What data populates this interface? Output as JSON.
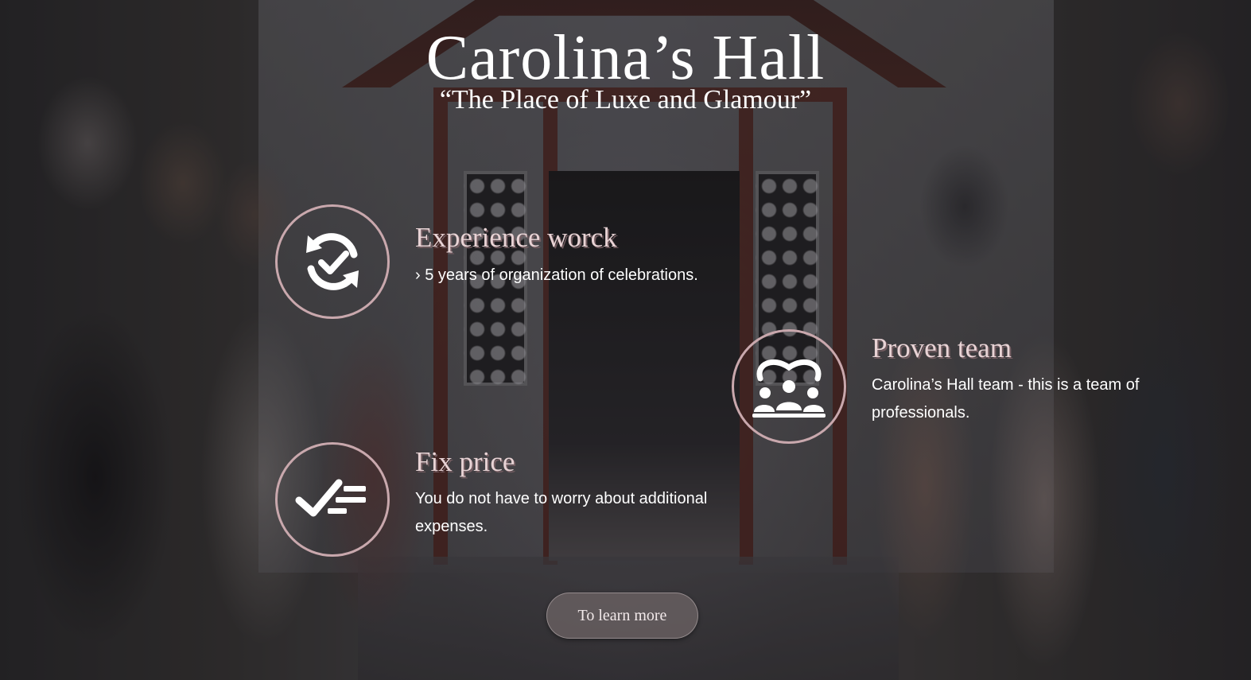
{
  "hero": {
    "title": "Carolina’s Hall",
    "subtitle": "“The Place of Luxe and Glamour”"
  },
  "features": [
    {
      "icon": "refresh-check-icon",
      "title": "Experience worck",
      "text": "› 5 years of organization of celebrations."
    },
    {
      "icon": "team-icon",
      "title": "Proven team",
      "text": "Carolina’s Hall team - this is a team of professionals."
    },
    {
      "icon": "check-list-icon",
      "title": "Fix price",
      "text": "You do not have to worry about additional expenses."
    }
  ],
  "cta": {
    "label": "To learn more"
  },
  "colors": {
    "accent_ring": "#c9a8ad",
    "feature_title": "#e8d3d5",
    "button_bg": "#6e6466"
  }
}
